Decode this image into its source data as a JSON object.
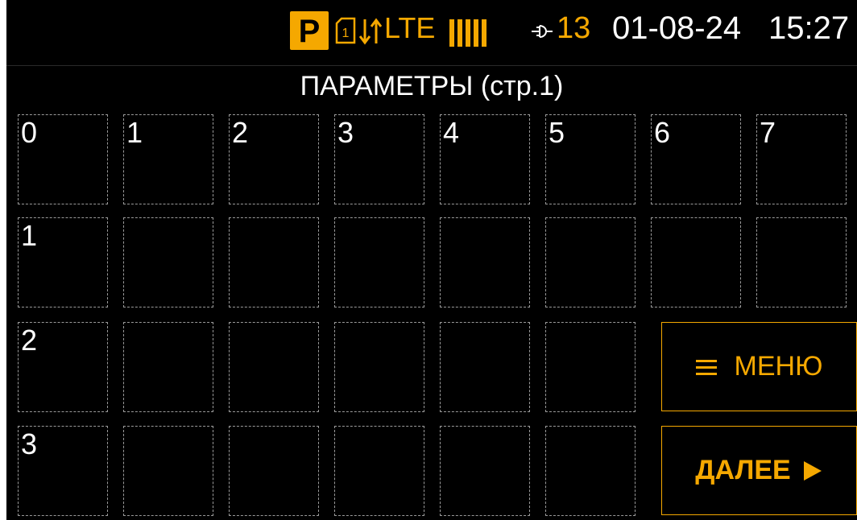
{
  "status_bar": {
    "mode_badge": "P",
    "sim_slot": "1",
    "network": "LTE",
    "count": "13",
    "date": "01-08-24",
    "time": "15:27",
    "icons": [
      "parking-badge-icon",
      "sim-card-icon",
      "signal-arrows-icon",
      "signal-bars-icon",
      "plug-icon"
    ],
    "accent_color": "#f5a800"
  },
  "page_title": "ПАРАМЕТРЫ (стр.1)",
  "grid": {
    "column_headers": [
      "0",
      "1",
      "2",
      "3",
      "4",
      "5",
      "6",
      "7"
    ],
    "row_headers": [
      "1",
      "2",
      "3"
    ]
  },
  "buttons": {
    "menu_label": "МЕНЮ",
    "next_label": "ДАЛЕЕ"
  }
}
